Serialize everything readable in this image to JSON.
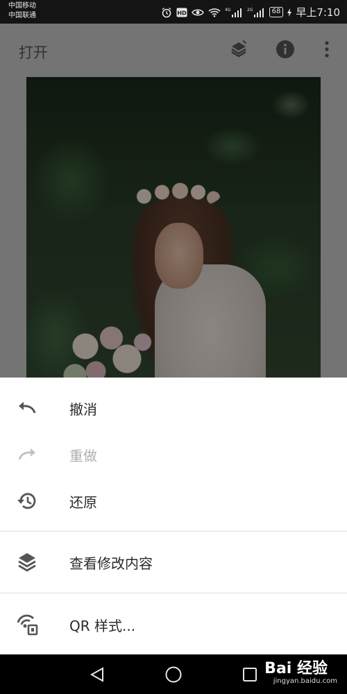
{
  "status_bar": {
    "carrier_1": "中国移动",
    "carrier_2": "中国联通",
    "network_1": "4G",
    "network_2": "2G",
    "battery": "68",
    "time": "早上7:10"
  },
  "toolbar": {
    "title": "打开"
  },
  "menu": {
    "items": [
      {
        "label": "撤消",
        "icon": "undo-icon",
        "enabled": true
      },
      {
        "label": "重做",
        "icon": "redo-icon",
        "enabled": false
      },
      {
        "label": "还原",
        "icon": "history-icon",
        "enabled": true
      },
      {
        "label": "查看修改内容",
        "icon": "layers-icon",
        "enabled": true
      },
      {
        "label": "QR 样式...",
        "icon": "qr-style-icon",
        "enabled": true
      }
    ]
  },
  "watermark": {
    "brand": "Bai 经验",
    "url": "jingyan.baidu.com"
  },
  "colors": {
    "sheet_bg": "#ffffff",
    "text": "#2a2a2a",
    "disabled": "#b0b0b0"
  }
}
